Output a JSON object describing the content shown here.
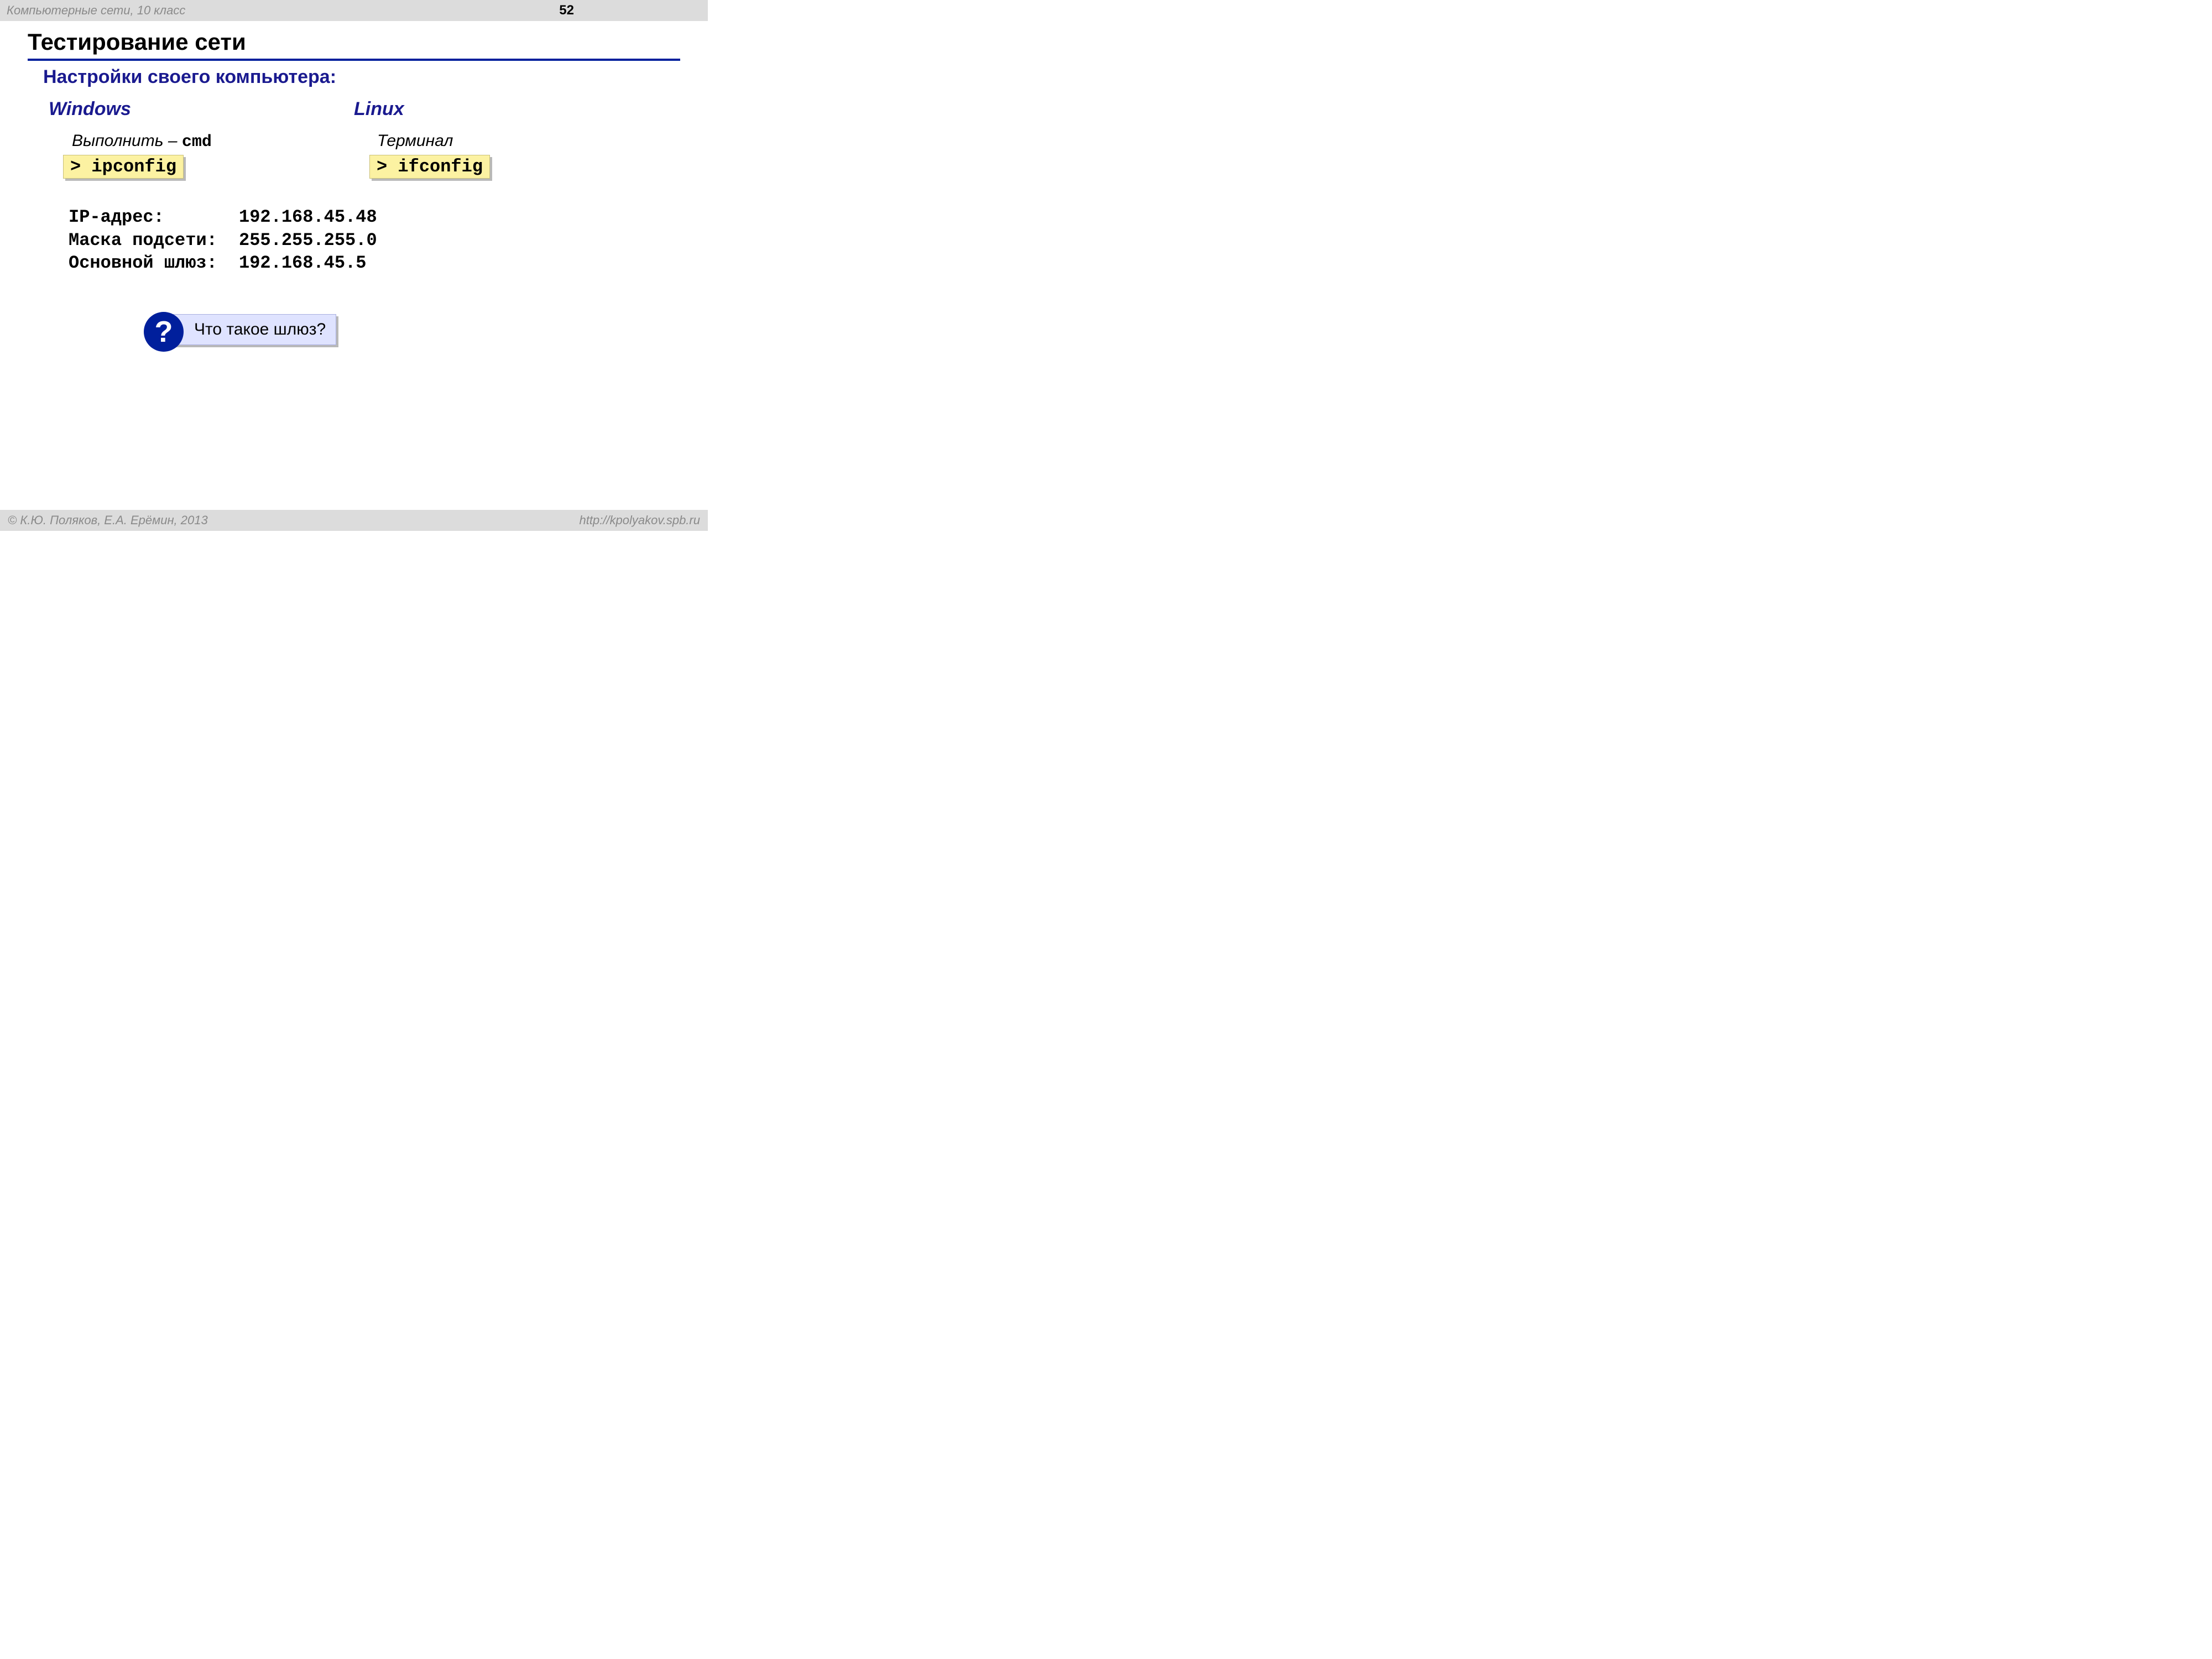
{
  "header": {
    "course": "Компьютерные сети, 10 класс",
    "page": "52"
  },
  "title": "Тестирование сети",
  "section": "Настройки своего компьютера:",
  "windows": {
    "heading": "Windows",
    "run_label": "Выполнить",
    "run_sep": " – ",
    "run_cmd": "cmd",
    "command": "> ipconfig"
  },
  "linux": {
    "heading": "Linux",
    "run_label": "Терминал",
    "command": "> ifconfig"
  },
  "output": {
    "rows": [
      {
        "label": "IP-адрес:",
        "value": "192.168.45.48"
      },
      {
        "label": "Маска подсети:",
        "value": "255.255.255.0"
      },
      {
        "label": "Основной шлюз:",
        "value": "192.168.45.5"
      }
    ]
  },
  "question": {
    "mark": "?",
    "text": "Что такое шлюз?"
  },
  "footer": {
    "copyright": "© К.Ю. Поляков, Е.А. Ерёмин, 2013",
    "url": "http://kpolyakov.spb.ru"
  }
}
